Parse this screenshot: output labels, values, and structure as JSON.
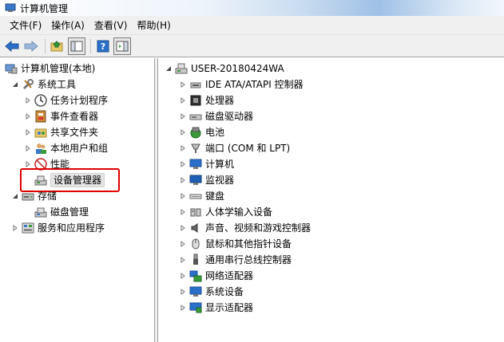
{
  "window": {
    "title": "计算机管理"
  },
  "menu": [
    "文件(F)",
    "操作(A)",
    "查看(V)",
    "帮助(H)"
  ],
  "toolbar": {
    "buttons": [
      "back-arrow-icon",
      "forward-arrow-icon",
      "up-folder-icon",
      "show-hide-tree-icon",
      "help-icon",
      "properties-icon"
    ]
  },
  "left_tree": {
    "root": "计算机管理(本地)",
    "system_tools": "系统工具",
    "task_scheduler": "任务计划程序",
    "event_viewer": "事件查看器",
    "shared_folders": "共享文件夹",
    "local_users": "本地用户和组",
    "performance": "性能",
    "device_manager": "设备管理器",
    "storage": "存储",
    "disk_management": "磁盘管理",
    "services": "服务和应用程序"
  },
  "device_tree": {
    "computer": "USER-20180424WA",
    "items": [
      "IDE ATA/ATAPI 控制器",
      "处理器",
      "磁盘驱动器",
      "电池",
      "端口 (COM 和 LPT)",
      "计算机",
      "监视器",
      "键盘",
      "人体学输入设备",
      "声音、视频和游戏控制器",
      "鼠标和其他指针设备",
      "通用串行总线控制器",
      "网络适配器",
      "系统设备",
      "显示适配器"
    ]
  },
  "colors": {
    "highlight_border": "#e00000",
    "accent_blue": "#2a6fc9"
  }
}
